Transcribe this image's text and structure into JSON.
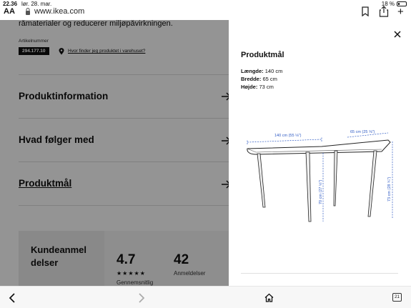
{
  "statusbar": {
    "time": "22.36",
    "date": "lør. 28. mar.",
    "battery": "18 %",
    "battery_fraction": 0.18
  },
  "browser": {
    "aa_label": "AA",
    "url": "www.ikea.com",
    "tabs_count": "21"
  },
  "page": {
    "intro_text": "råmaterialer og reducerer miljøpåvirkningen.",
    "article_label": "Artikelnummer",
    "article_number": "294.177.10",
    "find_link": "Hvor finder jeg produktet i varehuset?",
    "sections": [
      {
        "title": "Produktinformation"
      },
      {
        "title": "Hvad følger med"
      },
      {
        "title": "Produktmål"
      }
    ],
    "reviews": {
      "title": "Kundeanmel delser",
      "rating": "4.7",
      "stars": "★★★★★",
      "rating_label": "Gennemsnitlig",
      "count": "42",
      "count_label": "Anmeldelser"
    }
  },
  "panel": {
    "title": "Produktmål",
    "dims": [
      {
        "label": "Længde:",
        "value": "140 cm"
      },
      {
        "label": "Bredde:",
        "value": "65 cm"
      },
      {
        "label": "Højde:",
        "value": "73 cm"
      }
    ],
    "drawing_labels": {
      "length": "140 cm (55 ⅛\")",
      "width": "65 cm (25 ⅝\")",
      "leg_height": "70 cm (27 ½\")",
      "height": "73 cm (28 ¾\")"
    }
  },
  "colors": {
    "overlay": "rgba(0,0,0,0.42)",
    "measure_blue": "#2f5bc4"
  }
}
